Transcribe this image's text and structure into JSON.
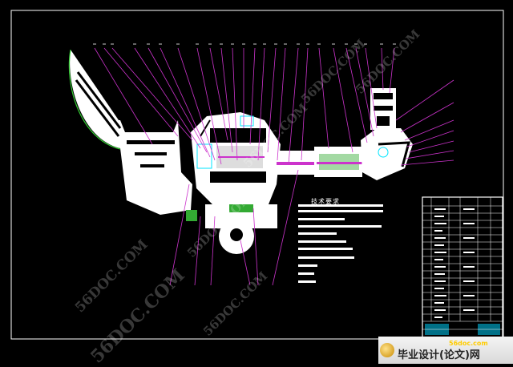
{
  "drawing": {
    "tech_requirements_title": "技术要求",
    "colors": {
      "background": "#000000",
      "frame": "#ffffff",
      "leaders": "#cc33cc",
      "cyan_lines": "#00e5ff",
      "green_hatch": "#33aa33",
      "table_lines": "#ffffff"
    }
  },
  "watermarks": [
    "56DOC.COM",
    "56DOC.COM",
    "56DOC.COM",
    "56DOC.COM",
    "56DOC.COM",
    "56DOC.COM",
    "56DOC.COM"
  ],
  "footer": {
    "site_url": "56doc.com",
    "brand": "毕业设计(论文)网"
  }
}
